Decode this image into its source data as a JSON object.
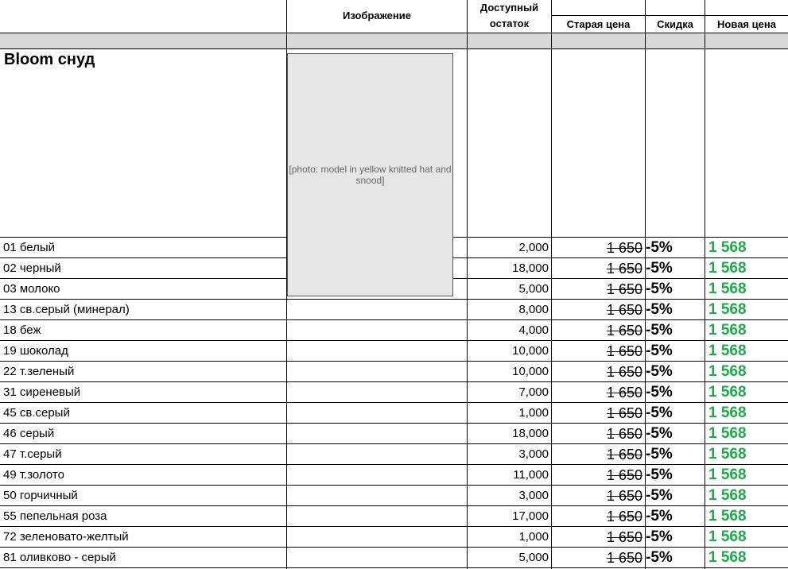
{
  "header": {
    "image_label": "Изображение",
    "stock_label_line1": "Доступный",
    "stock_label_line2": "остаток",
    "old_price_label": "Старая цена",
    "discount_label": "Скидка",
    "new_price_label": "Новая цена"
  },
  "product": {
    "title": "Bloom снуд",
    "photo_alt": "[photo: model in yellow knitted hat and snood]"
  },
  "colors": {
    "new_price": "#1faa4a",
    "band": "#d8d8d8"
  },
  "rows": [
    {
      "name": "01 белый",
      "stock": "2,000",
      "old_price": "1 650",
      "discount": "-5%",
      "new_price": "1 568"
    },
    {
      "name": "02 черный",
      "stock": "18,000",
      "old_price": "1 650",
      "discount": "-5%",
      "new_price": "1 568"
    },
    {
      "name": "03 молоко",
      "stock": "5,000",
      "old_price": "1 650",
      "discount": "-5%",
      "new_price": "1 568"
    },
    {
      "name": "13 св.серый (минерал)",
      "stock": "8,000",
      "old_price": "1 650",
      "discount": "-5%",
      "new_price": "1 568"
    },
    {
      "name": "18 беж",
      "stock": "4,000",
      "old_price": "1 650",
      "discount": "-5%",
      "new_price": "1 568"
    },
    {
      "name": "19 шоколад",
      "stock": "10,000",
      "old_price": "1 650",
      "discount": "-5%",
      "new_price": "1 568"
    },
    {
      "name": "22 т.зеленый",
      "stock": "10,000",
      "old_price": "1 650",
      "discount": "-5%",
      "new_price": "1 568"
    },
    {
      "name": "31 сиреневый",
      "stock": "7,000",
      "old_price": "1 650",
      "discount": "-5%",
      "new_price": "1 568"
    },
    {
      "name": "45 св.серый",
      "stock": "1,000",
      "old_price": "1 650",
      "discount": "-5%",
      "new_price": "1 568"
    },
    {
      "name": "46 серый",
      "stock": "18,000",
      "old_price": "1 650",
      "discount": "-5%",
      "new_price": "1 568"
    },
    {
      "name": "47 т.серый",
      "stock": "3,000",
      "old_price": "1 650",
      "discount": "-5%",
      "new_price": "1 568"
    },
    {
      "name": "49 т.золото",
      "stock": "11,000",
      "old_price": "1 650",
      "discount": "-5%",
      "new_price": "1 568"
    },
    {
      "name": "50 горчичный",
      "stock": "3,000",
      "old_price": "1 650",
      "discount": "-5%",
      "new_price": "1 568"
    },
    {
      "name": "55 пепельная роза",
      "stock": "17,000",
      "old_price": "1 650",
      "discount": "-5%",
      "new_price": "1 568"
    },
    {
      "name": "72 зеленовато-желтый",
      "stock": "1,000",
      "old_price": "1 650",
      "discount": "-5%",
      "new_price": "1 568"
    },
    {
      "name": "81 оливково - серый",
      "stock": "5,000",
      "old_price": "1 650",
      "discount": "-5%",
      "new_price": "1 568"
    }
  ]
}
